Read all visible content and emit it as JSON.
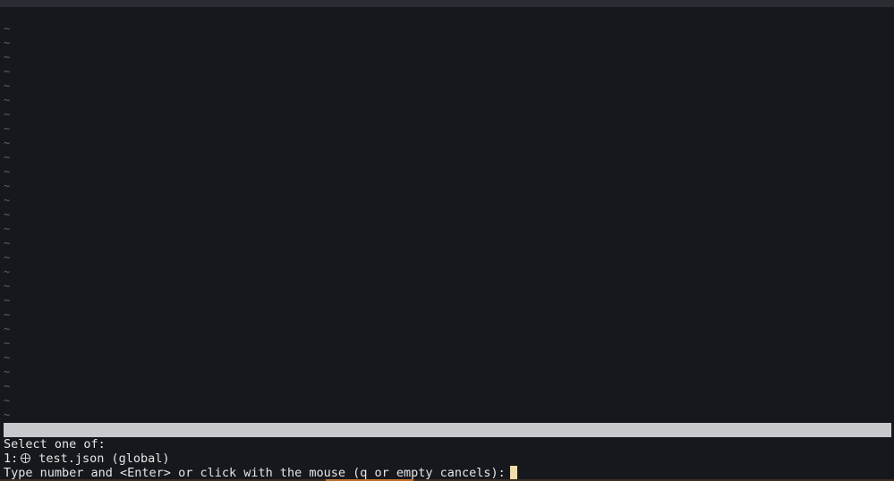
{
  "editor": {
    "empty_line_marker": "~",
    "empty_line_count": 28
  },
  "prompt": {
    "header": "Select one of:",
    "option_number": "1:",
    "option_icon": "globe-icon",
    "option_label": "test.json (global)",
    "instruction": "Type number and <Enter> or click with the mouse (q or empty cancels):"
  },
  "colors": {
    "background": "#17181d",
    "tilde": "#5c6370",
    "statusline": "#c8c9cc",
    "cursor": "#f0dcaa",
    "accent": "#c0702e"
  }
}
